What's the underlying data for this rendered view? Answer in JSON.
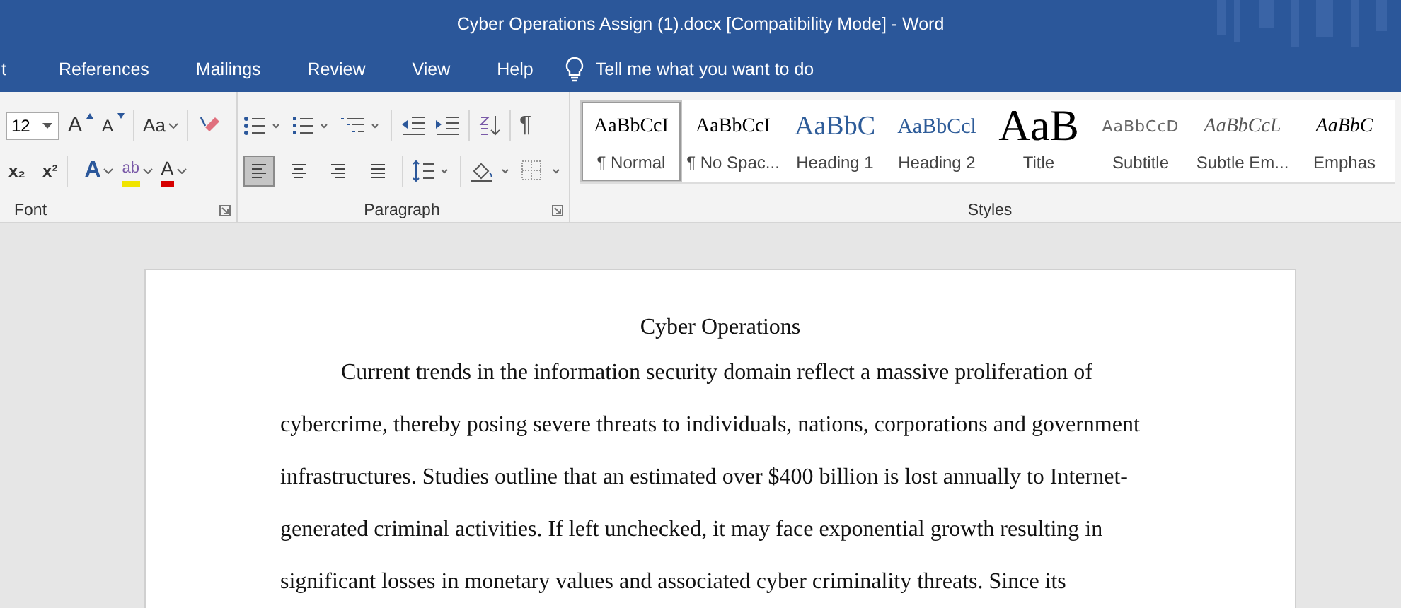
{
  "window": {
    "title": "Cyber Operations Assign (1).docx [Compatibility Mode]  -  Word"
  },
  "tabs": [
    {
      "label": "t",
      "selected": false
    },
    {
      "label": "References",
      "selected": false
    },
    {
      "label": "Mailings",
      "selected": false
    },
    {
      "label": "Review",
      "selected": false
    },
    {
      "label": "View",
      "selected": false
    },
    {
      "label": "Help",
      "selected": false
    }
  ],
  "tell_me": {
    "placeholder": "Tell me what you want to do"
  },
  "font_group": {
    "label": "Font",
    "size": "12",
    "grow": "A",
    "shrink": "A",
    "change_case": "Aa",
    "subscript": "x₂",
    "superscript": "x²",
    "text_effects": "A",
    "highlight": "ab",
    "font_color": "A"
  },
  "paragraph_group": {
    "label": "Paragraph",
    "show_marks": "¶",
    "alignments": [
      {
        "kind": "left",
        "selected": true
      },
      {
        "kind": "center",
        "selected": false
      },
      {
        "kind": "right",
        "selected": false
      },
      {
        "kind": "justify",
        "selected": false
      }
    ]
  },
  "styles_group": {
    "label": "Styles",
    "items": [
      {
        "kind": "normal",
        "preview": "AaBbCcI",
        "label": "¶ Normal",
        "selected": true
      },
      {
        "kind": "nospacing",
        "preview": "AaBbCcI",
        "label": "¶ No Spac...",
        "selected": false
      },
      {
        "kind": "heading1",
        "preview": "AaBbC",
        "label": "Heading 1",
        "selected": false
      },
      {
        "kind": "heading2",
        "preview": "AaBbCcl",
        "label": "Heading 2",
        "selected": false
      },
      {
        "kind": "title",
        "preview": "AaB",
        "label": "Title",
        "selected": false
      },
      {
        "kind": "subtitle",
        "preview": "AaBbCcD",
        "label": "Subtitle",
        "selected": false
      },
      {
        "kind": "subtle",
        "preview": "AaBbCcL",
        "label": "Subtle Em...",
        "selected": false
      },
      {
        "kind": "emphasis",
        "preview": "AaBbC",
        "label": "Emphas",
        "selected": false
      }
    ]
  },
  "document": {
    "title": "Cyber Operations",
    "lines": [
      "Current trends in the information security domain reflect a massive proliferation of",
      "cybercrime, thereby posing severe threats to individuals, nations, corporations and government",
      "infrastructures. Studies outline that an estimated over $400 billion is lost annually to Internet-",
      "generated criminal activities. If left unchecked, it may face exponential growth resulting in",
      "significant losses in monetary values and associated cyber criminality threats. Since its"
    ]
  }
}
